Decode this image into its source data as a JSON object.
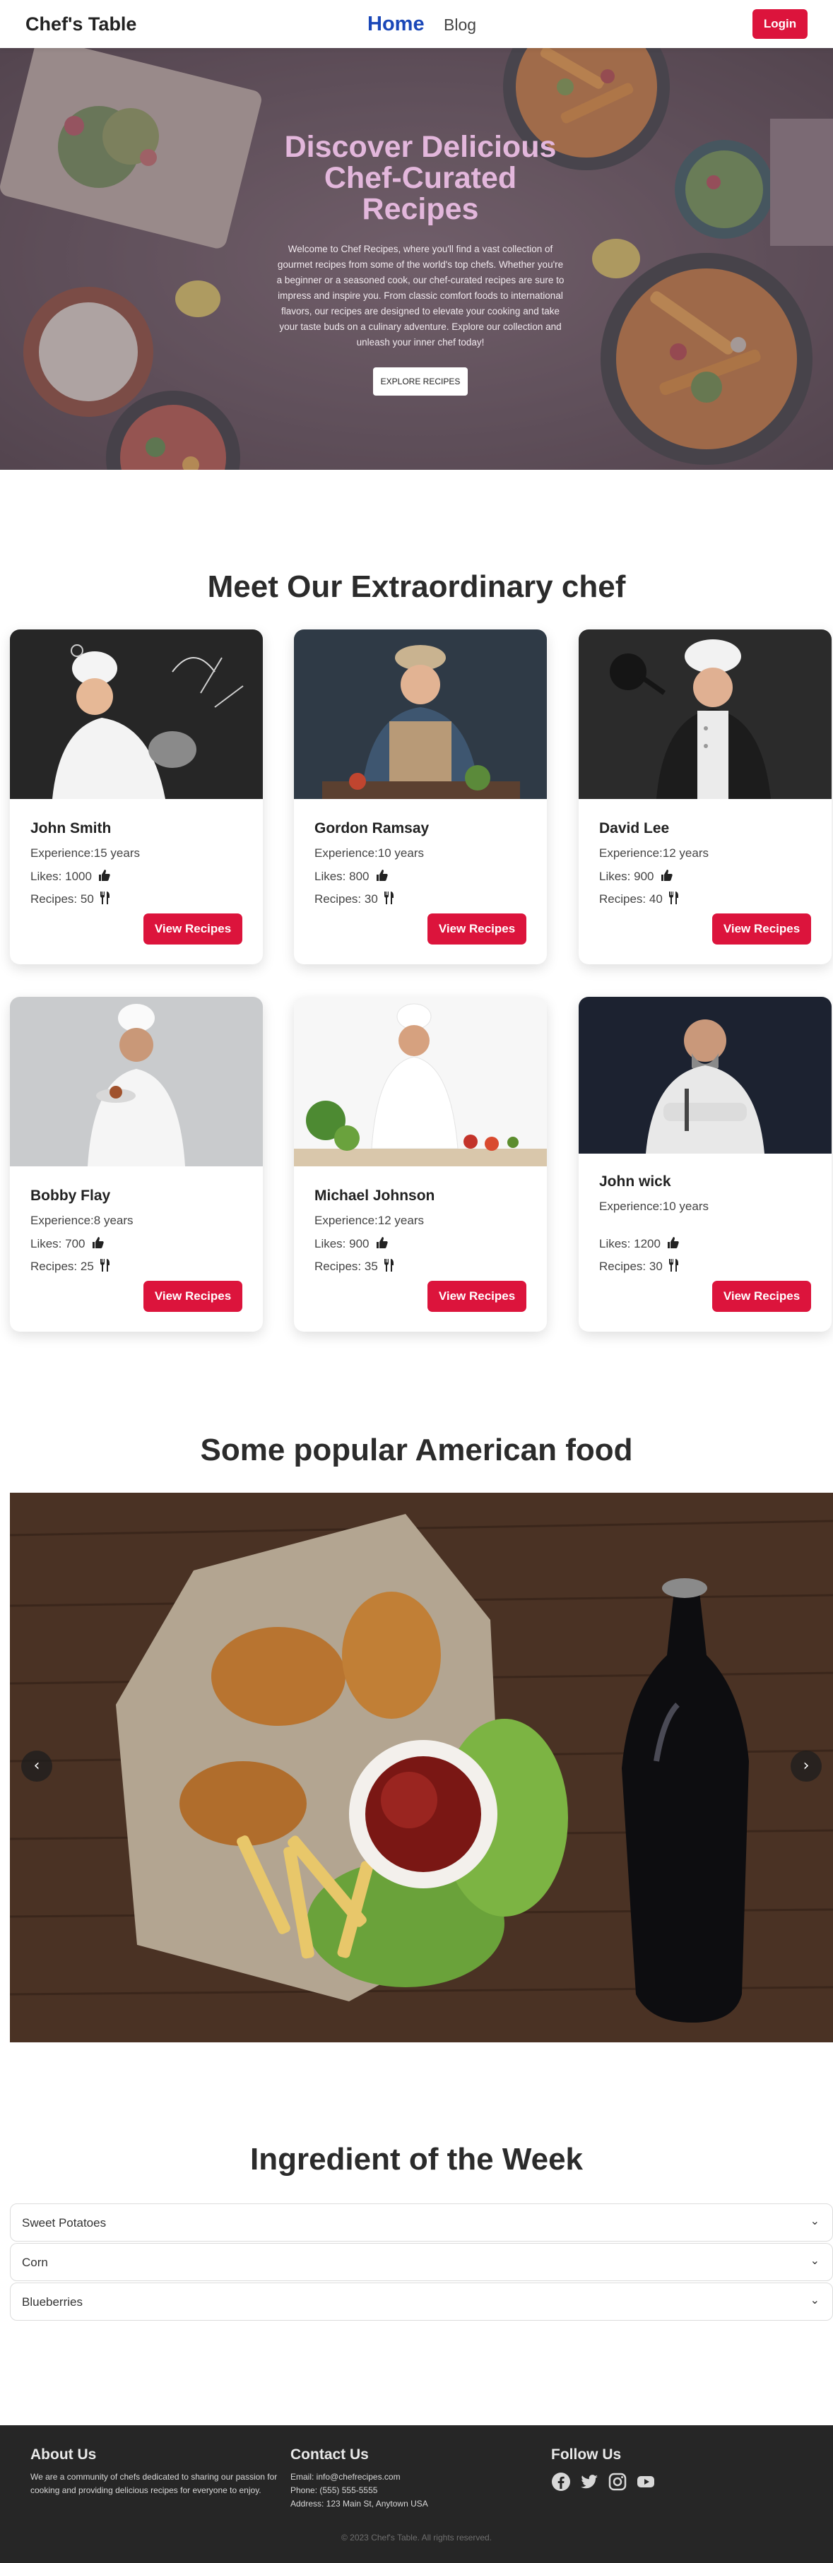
{
  "navbar": {
    "brand": "Chef's Table",
    "home": "Home",
    "blog": "Blog",
    "login": "Login"
  },
  "hero": {
    "title": "Discover Delicious Chef-Curated Recipes",
    "text": "Welcome to Chef Recipes, where you'll find a vast collection of gourmet recipes from some of the world's top chefs. Whether you're a beginner or a seasoned cook, our chef-curated recipes are sure to impress and inspire you. From classic comfort foods to international flavors, our recipes are designed to elevate your cooking and take your taste buds on a culinary adventure. Explore our collection and unleash your inner chef today!",
    "button": "EXPLORE RECIPES"
  },
  "chefs_section": {
    "title": "Meet Our Extraordinary chef",
    "chefs": [
      {
        "name": "John Smith",
        "experience": "Experience:15 years",
        "likes": "Likes: 1000",
        "recipes": "Recipes: 50",
        "button": "View Recipes"
      },
      {
        "name": "Gordon Ramsay",
        "experience": "Experience:10 years",
        "likes": "Likes: 800",
        "recipes": "Recipes: 30",
        "button": "View Recipes"
      },
      {
        "name": "David Lee",
        "experience": "Experience:12 years",
        "likes": "Likes: 900",
        "recipes": "Recipes: 40",
        "button": "View Recipes"
      },
      {
        "name": "Bobby Flay",
        "experience": "Experience:8 years",
        "likes": "Likes: 700",
        "recipes": "Recipes: 25",
        "button": "View Recipes"
      },
      {
        "name": "Michael Johnson",
        "experience": "Experience:12 years",
        "likes": "Likes: 900",
        "recipes": "Recipes: 35",
        "button": "View Recipes"
      },
      {
        "name": "John wick",
        "experience": "Experience:10 years",
        "likes": "Likes: 1200",
        "recipes": "Recipes: 30",
        "button": "View Recipes"
      }
    ]
  },
  "food_section": {
    "title": "Some popular American food",
    "prev": "‹",
    "next": "›"
  },
  "ingredient_section": {
    "title": "Ingredient of the Week",
    "items": [
      "Sweet Potatoes",
      "Corn",
      "Blueberries"
    ]
  },
  "footer": {
    "about_title": "About Us",
    "about_text": "We are a community of chefs dedicated to sharing our passion for cooking and providing delicious recipes for everyone to enjoy.",
    "contact_title": "Contact Us",
    "email": "Email: info@chefrecipes.com",
    "phone": "Phone: (555) 555-5555",
    "address": "Address: 123 Main St, Anytown USA",
    "follow_title": "Follow Us",
    "copyright": "© 2023 Chef's Table. All rights reserved."
  },
  "colors": {
    "accent": "#dc143c",
    "nav_active": "#1a47b8",
    "hero_title": "#e3b7dc",
    "footer_bg": "#262626"
  },
  "icons": [
    "thumbs-up-icon",
    "utensils-icon",
    "chevron-down-icon",
    "facebook-icon",
    "twitter-icon",
    "instagram-icon",
    "youtube-icon"
  ]
}
